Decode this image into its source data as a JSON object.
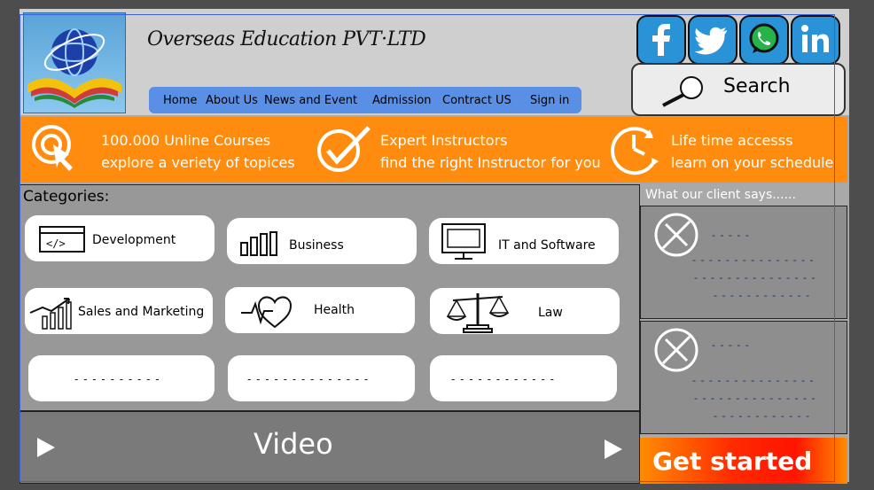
{
  "brand": {
    "title": "Overseas Education PVT·LTD",
    "logo": "globe-book-logo"
  },
  "nav": [
    "Home",
    "About Us",
    "News and Event",
    "Admission",
    "Contract US",
    "Sign in"
  ],
  "social": [
    {
      "name": "facebook-icon",
      "glyph": "f"
    },
    {
      "name": "twitter-icon",
      "glyph": "🐦"
    },
    {
      "name": "whatsapp-icon",
      "glyph": "✆"
    },
    {
      "name": "linkedin-icon",
      "glyph": "in"
    }
  ],
  "search": {
    "label": "Search",
    "icon": "magnifier-icon"
  },
  "features": [
    {
      "line1": "100.000 Unline Courses",
      "line2": "explore a veriety of topices",
      "icon": "cursor-target-icon"
    },
    {
      "line1": "Expert Instructors",
      "line2": "find the right Instructor for you",
      "icon": "checkmark-icon"
    },
    {
      "line1": "Life time accesss",
      "line2": "learn on your schedule",
      "icon": "clock-icon"
    }
  ],
  "categories": {
    "title": "Categories:",
    "items": [
      "Development",
      "Business",
      "IT and Software",
      "Sales and Marketing",
      "Health",
      "Law"
    ],
    "placeholders": [
      "- - - - - - - - - -",
      "- - - - - - - - - - - - - -",
      "- - - - - - - - - - - -"
    ]
  },
  "video": {
    "label": "Video"
  },
  "testimonials": {
    "title": "What our client says......",
    "lines": [
      "- - - - -",
      "- - - - - - - - - - - - - - -",
      "- - - - - - - - - - - - - - -",
      "- - - - - - - - - - - -"
    ]
  },
  "cta": {
    "label": "Get started"
  },
  "colors": {
    "orange": "#ff8c0f",
    "nav_blue": "#5a8fe6",
    "social_blue": "#2a93d8",
    "whatsapp_green": "#25b34a"
  }
}
